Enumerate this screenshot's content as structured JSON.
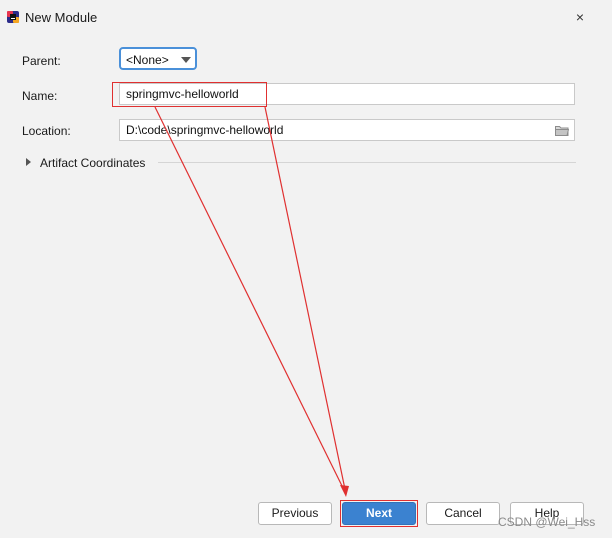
{
  "window": {
    "title": "New Module",
    "close_glyph": "×",
    "icon": "intellij-app-icon"
  },
  "form": {
    "parent_label": "Parent:",
    "parent_value": "<None>",
    "name_label": "Name:",
    "name_value": "springmvc-helloworld",
    "location_label": "Location:",
    "location_value": "D:\\code\\springmvc-helloworld",
    "artifact_label": "Artifact Coordinates"
  },
  "buttons": {
    "previous": "Previous",
    "next": "Next",
    "cancel": "Cancel",
    "help": "Help"
  },
  "watermark": "CSDN @Wei_Hss",
  "colors": {
    "primary": "#3b82d0",
    "annotation": "#e03030",
    "focus": "#4a90d9"
  }
}
